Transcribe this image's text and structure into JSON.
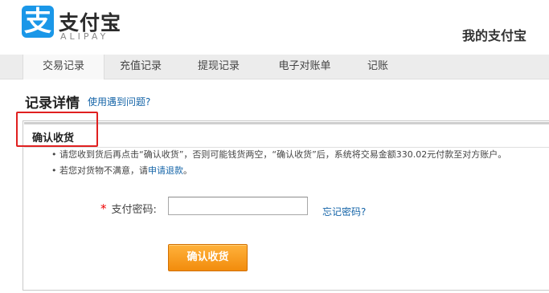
{
  "header": {
    "logo_cn": "支付宝",
    "logo_en": "ALIPAY",
    "my_alipay": "我的支付宝",
    "brand_color": "#1a97e8"
  },
  "nav": {
    "items": [
      {
        "label": "交易记录",
        "active": true
      },
      {
        "label": "充值记录",
        "active": false
      },
      {
        "label": "提现记录",
        "active": false
      },
      {
        "label": "电子对账单",
        "active": false
      },
      {
        "label": "记账",
        "active": false
      }
    ]
  },
  "page": {
    "title": "记录详情",
    "help_link": "使用遇到问题?"
  },
  "panel": {
    "title": "确认收货",
    "notice_1_prefix": "请您收到货后再点击“确认收货”，否则可能钱货两空，“确认收货”后，系统将交易金额",
    "notice_1_amount": "330.02",
    "notice_1_suffix": "元付款至对方账户。",
    "notice_2_prefix": "若您对货物不满意，请",
    "notice_2_link": "申请退款",
    "notice_2_suffix": "。",
    "highlight_color": "#e02020"
  },
  "form": {
    "password_label": "支付密码:",
    "required_mark": "*",
    "password_value": "",
    "forgot_link": "忘记密码?",
    "confirm_button": "确认收货",
    "button_color": "#f28c0c"
  }
}
